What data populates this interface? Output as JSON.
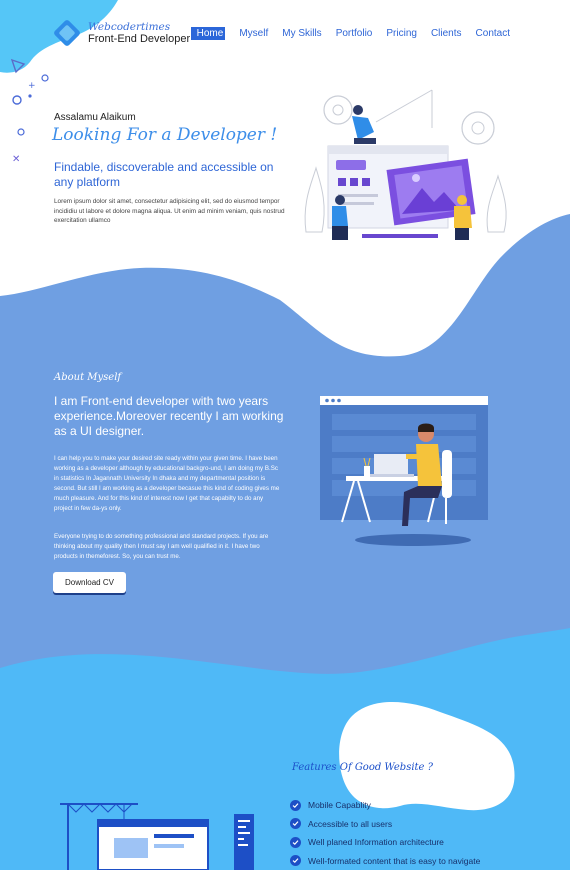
{
  "brand": {
    "name": "Webcodertimes",
    "tagline": "Front-End Developer"
  },
  "nav": {
    "items": [
      {
        "label": "Home"
      },
      {
        "label": "Myself"
      },
      {
        "label": "My Skills"
      },
      {
        "label": "Portfolio"
      },
      {
        "label": "Pricing"
      },
      {
        "label": "Clients"
      },
      {
        "label": "Contact"
      }
    ]
  },
  "hero": {
    "greeting": "Assalamu Alaikum",
    "title": "Looking For a Developer !",
    "subtitle": "Findable, discoverable and accessible on any platform",
    "text": "Lorem ipsum dolor sit amet, consectetur adipisicing elit, sed do eiusmod tempor incididiu ut labore et dolore magna aliqua. Ut enim ad minim veniam, quis nostrud exercitation ullamco"
  },
  "about": {
    "heading": "About Myself",
    "lead": "I am Front-end developer with two years experience.Moreover recently I am working as a UI designer.",
    "paragraph1": "I can help you to make your desired site ready within your given time. I have been working as a developer although by educational backgro-und, I am doing my B.Sc in statistics In Jagannath University In dhaka and my departmental position is second. But still I am working as a developer becasue this kind of coding gives me much pleasure. And for this kind of interest now I get that capabilty to do any project in few da-ys only.",
    "paragraph2": "Everyone trying to do something professional and standard projects. If you are thinking about my quality then I must say I am well qualified in it. I have two products in themeforest. So, you can trust me.",
    "cv_button": "Download CV"
  },
  "features": {
    "heading": "Features Of Good Website ?",
    "items": [
      "Mobile Capablity",
      "Accessible to all users",
      "Well planed Information architecture",
      "Well-formated content that is easy to navigate"
    ]
  },
  "colors": {
    "primary": "#6f9fe2",
    "light_blue": "#4fb9f7",
    "accent": "#2b66d9",
    "purple": "#7b4fe0",
    "yellow": "#f5c33b"
  }
}
